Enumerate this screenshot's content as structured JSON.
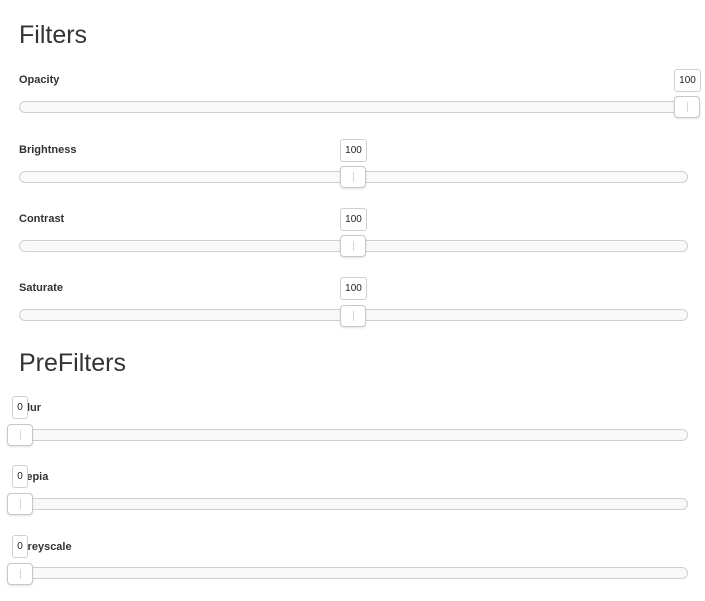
{
  "filters": {
    "title": "Filters",
    "controls": [
      {
        "label": "Opacity",
        "value": "100",
        "fraction": 1.0
      },
      {
        "label": "Brightness",
        "value": "100",
        "fraction": 0.5
      },
      {
        "label": "Contrast",
        "value": "100",
        "fraction": 0.5
      },
      {
        "label": "Saturate",
        "value": "100",
        "fraction": 0.5
      }
    ]
  },
  "prefilters": {
    "title": "PreFilters",
    "controls": [
      {
        "label": "Blur",
        "value": "0",
        "fraction": 0.0
      },
      {
        "label": "Sepia",
        "value": "0",
        "fraction": 0.0
      },
      {
        "label": "Greyscale",
        "value": "0",
        "fraction": 0.0
      }
    ]
  }
}
